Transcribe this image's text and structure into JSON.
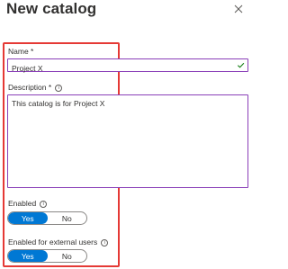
{
  "panel": {
    "title": "New catalog",
    "close_icon": "close-icon"
  },
  "form": {
    "name": {
      "label": "Name *",
      "value": "Project X",
      "valid_icon": "checkmark-icon"
    },
    "description": {
      "label": "Description *",
      "value": "This catalog is for Project X",
      "info_icon": "info-icon"
    },
    "enabled": {
      "label": "Enabled",
      "info_icon": "info-icon",
      "options": [
        "Yes",
        "No"
      ],
      "selected": "Yes"
    },
    "enabled_external": {
      "label": "Enabled for external users",
      "info_icon": "info-icon",
      "options": [
        "Yes",
        "No"
      ],
      "selected": "Yes"
    }
  },
  "colors": {
    "accent": "#0078d4",
    "focus_border": "#8a3fb8",
    "highlight": "#e53935",
    "valid": "#107c10"
  }
}
